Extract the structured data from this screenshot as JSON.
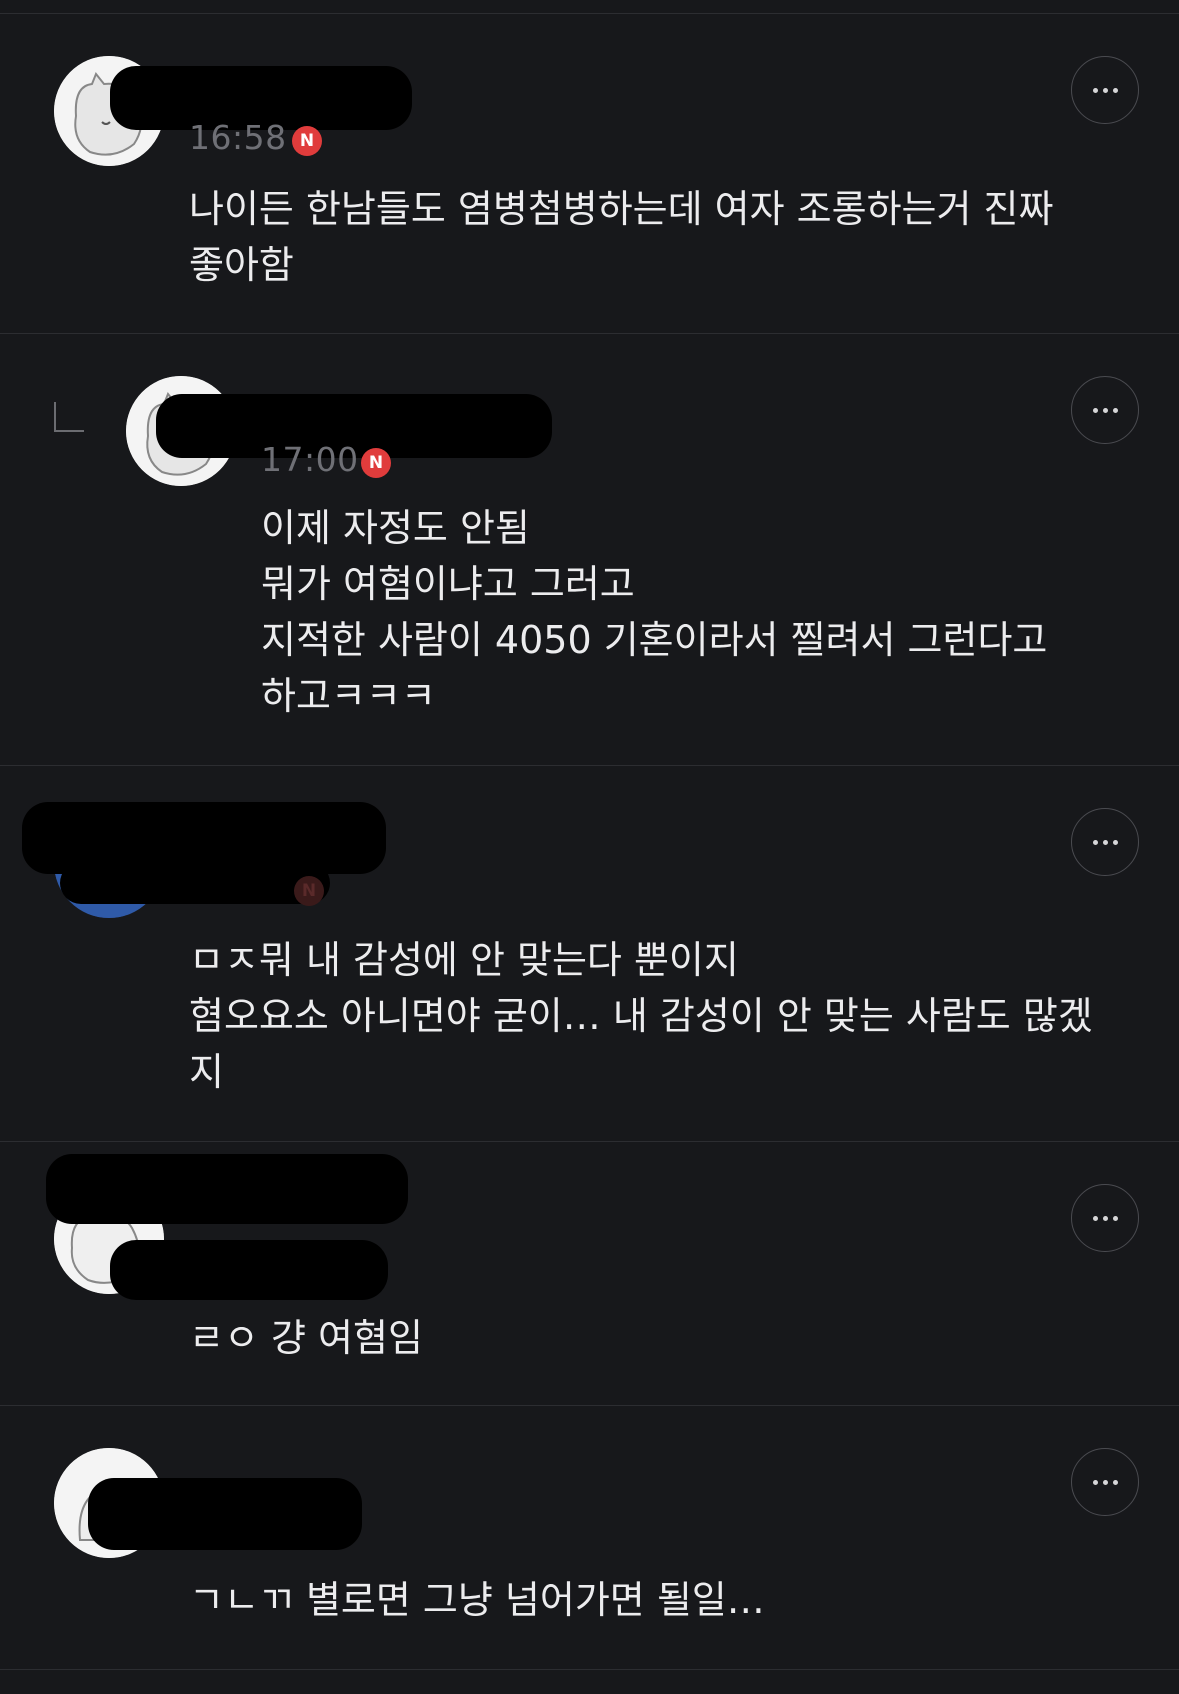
{
  "comments": [
    {
      "time": "16:58",
      "badge": "N",
      "text": "나이든 한남들도 염병첨병하는데 여자 조롱하는거 진짜\n좋아함"
    },
    {
      "time": "17:00",
      "badge": "N",
      "text": "이제 자정도 안됨\n뭐가 여혐이냐고 그러고\n지적한 사람이 4050 기혼이라서 찔려서 그런다고\n하고ㅋㅋㅋ"
    },
    {
      "time": "",
      "badge": "N",
      "text": "ㅁㅈ뭐 내 감성에 안 맞는다 뿐이지\n혐오요소 아니면야 굳이… 내 감성이 안 맞는 사람도 많겠\n지"
    },
    {
      "time": "",
      "badge": "",
      "text": "ㄹㅇ 걍 여혐임"
    },
    {
      "time": "",
      "badge": "",
      "text": "ㄱㄴㄲ 별로면 그냥 넘어가면 될일…"
    }
  ],
  "icons": {
    "more": "more-options-icon",
    "reply": "reply-arrow-icon",
    "new": "new-badge-icon"
  },
  "colors": {
    "background": "#17181b",
    "divider": "#2c2d31",
    "badge": "#e03c3c",
    "time": "#6f7076",
    "text": "#ececee"
  }
}
